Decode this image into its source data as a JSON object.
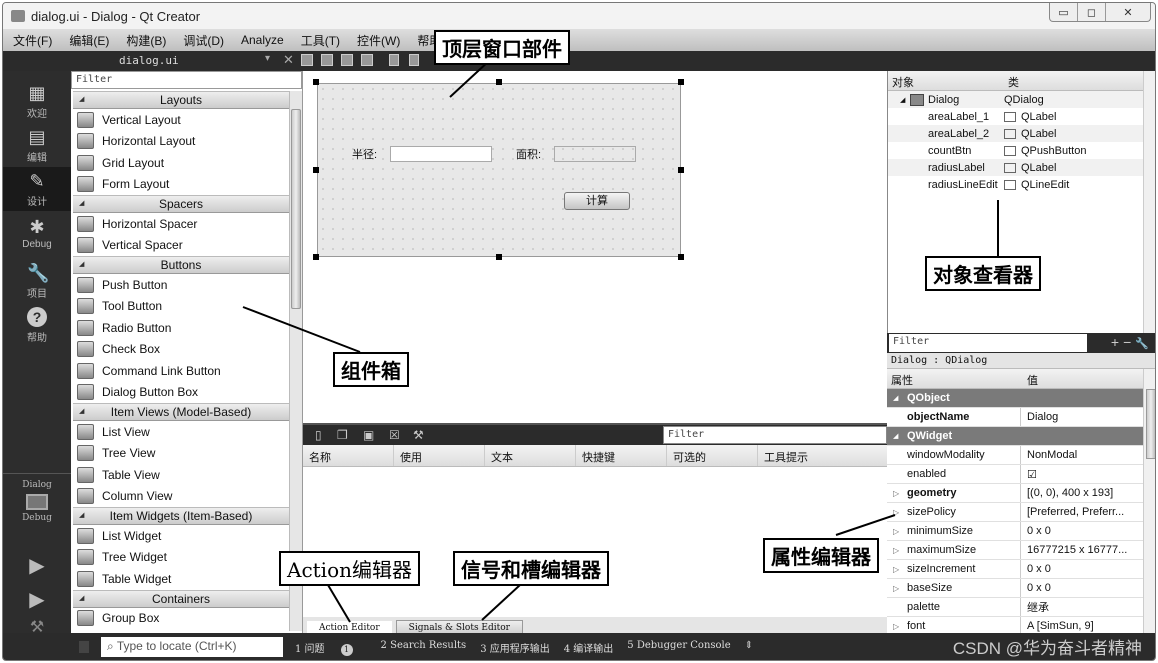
{
  "window": {
    "title": "dialog.ui - Dialog - Qt Creator",
    "controls": {
      "minimize": "▭",
      "maximize": "◻",
      "close": "✕"
    }
  },
  "menu": [
    "文件(F)",
    "编辑(E)",
    "构建(B)",
    "调试(D)",
    "Analyze",
    "工具(T)",
    "控件(W)",
    "帮助(H)"
  ],
  "toolbar": {
    "file": "dialog.ui",
    "dropdown": "▾",
    "close": "✕"
  },
  "modes": [
    {
      "label": "欢迎",
      "icon": "grid-icon",
      "glyph": "▦"
    },
    {
      "label": "编辑",
      "icon": "edit-icon",
      "glyph": "▤"
    },
    {
      "label": "设计",
      "icon": "pencil-icon",
      "glyph": "✎",
      "active": true
    },
    {
      "label": "Debug",
      "icon": "bug-icon",
      "glyph": "✱"
    },
    {
      "label": "项目",
      "icon": "wrench-icon",
      "glyph": "🔧"
    },
    {
      "label": "帮助",
      "icon": "help-icon",
      "glyph": "?"
    }
  ],
  "kit": {
    "project": "Dialog",
    "mode": "Debug"
  },
  "widgetbox": {
    "filter_placeholder": "Filter",
    "categories": [
      {
        "name": "Layouts",
        "items": [
          "Vertical Layout",
          "Horizontal Layout",
          "Grid Layout",
          "Form Layout"
        ]
      },
      {
        "name": "Spacers",
        "items": [
          "Horizontal Spacer",
          "Vertical Spacer"
        ]
      },
      {
        "name": "Buttons",
        "items": [
          "Push Button",
          "Tool Button",
          "Radio Button",
          "Check Box",
          "Command Link Button",
          "Dialog Button Box"
        ]
      },
      {
        "name": "Item Views (Model-Based)",
        "items": [
          "List View",
          "Tree View",
          "Table View",
          "Column View"
        ]
      },
      {
        "name": "Item Widgets (Item-Based)",
        "items": [
          "List Widget",
          "Tree Widget",
          "Table Widget"
        ]
      },
      {
        "name": "Containers",
        "items": [
          "Group Box"
        ]
      }
    ]
  },
  "form": {
    "radius_label": "半径:",
    "area_label": "面积:",
    "count_button": "计算"
  },
  "action_editor": {
    "filter_placeholder": "Filter",
    "columns": [
      "名称",
      "使用",
      "文本",
      "快捷键",
      "可选的",
      "工具提示"
    ],
    "tabs": [
      "Action Editor",
      "Signals & Slots Editor"
    ]
  },
  "object_inspector": {
    "columns": [
      "对象",
      "类"
    ],
    "rows": [
      {
        "name": "Dialog",
        "class": "QDialog",
        "root": true
      },
      {
        "name": "areaLabel_1",
        "class": "QLabel"
      },
      {
        "name": "areaLabel_2",
        "class": "QLabel"
      },
      {
        "name": "countBtn",
        "class": "QPushButton"
      },
      {
        "name": "radiusLabel",
        "class": "QLabel"
      },
      {
        "name": "radiusLineEdit",
        "class": "QLineEdit"
      }
    ]
  },
  "property_editor": {
    "filter_placeholder": "Filter",
    "buttons": [
      "+",
      "−",
      "🔧"
    ],
    "class_line": "Dialog : QDialog",
    "columns": [
      "属性",
      "值"
    ],
    "rows": [
      {
        "name": "QObject",
        "value": "",
        "type": "group"
      },
      {
        "name": "objectName",
        "value": "Dialog",
        "type": "bold"
      },
      {
        "name": "QWidget",
        "value": "",
        "type": "group"
      },
      {
        "name": "windowModality",
        "value": "NonModal"
      },
      {
        "name": "enabled",
        "value": "☑"
      },
      {
        "name": "geometry",
        "value": "[(0, 0), 400 x 193]",
        "type": "bold",
        "expand": true
      },
      {
        "name": "sizePolicy",
        "value": "[Preferred, Preferr...",
        "expand": true
      },
      {
        "name": "minimumSize",
        "value": "0 x 0",
        "expand": true
      },
      {
        "name": "maximumSize",
        "value": "16777215 x 16777...",
        "expand": true
      },
      {
        "name": "sizeIncrement",
        "value": "0 x 0",
        "expand": true
      },
      {
        "name": "baseSize",
        "value": "0 x 0",
        "expand": true
      },
      {
        "name": "palette",
        "value": "继承"
      },
      {
        "name": "font",
        "value": "A  [SimSun, 9]",
        "expand": true
      }
    ]
  },
  "statusbar": {
    "locate_placeholder": "Type to locate (Ctrl+K)",
    "tabs": [
      "1 问题",
      "2 Search Results",
      "3 应用程序输出",
      "4 编译输出",
      "5 Debugger Console"
    ],
    "issues_badge": "1"
  },
  "callouts": {
    "top_level": "顶层窗口部件",
    "widget_box": "组件箱",
    "object_inspector": "对象查看器",
    "action_editor": "Action编辑器",
    "signal_slot_editor": "信号和槽编辑器",
    "property_editor": "属性编辑器"
  },
  "watermark": "CSDN @华为奋斗者精神"
}
